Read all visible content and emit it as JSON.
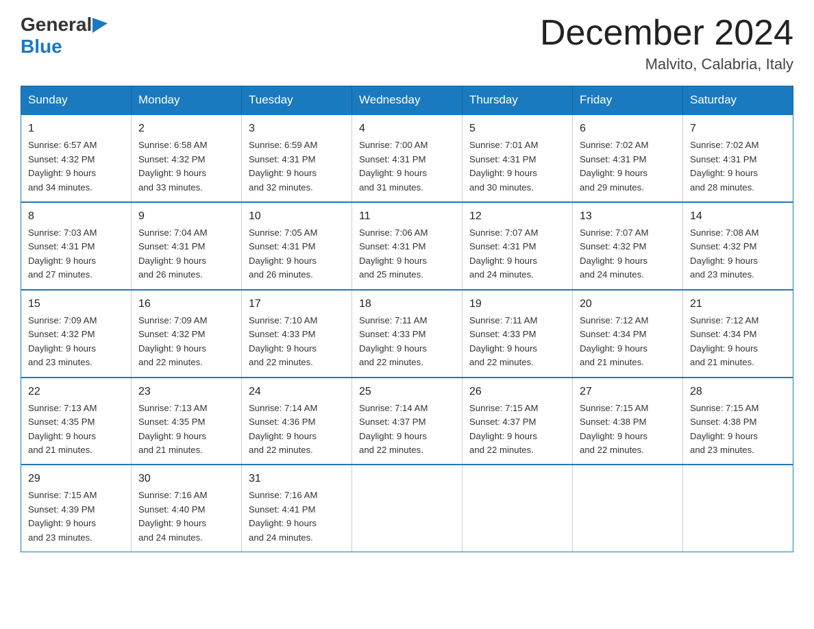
{
  "header": {
    "logo_general": "General",
    "logo_blue": "Blue",
    "title": "December 2024",
    "subtitle": "Malvito, Calabria, Italy"
  },
  "days_of_week": [
    "Sunday",
    "Monday",
    "Tuesday",
    "Wednesday",
    "Thursday",
    "Friday",
    "Saturday"
  ],
  "weeks": [
    [
      {
        "day": "1",
        "sunrise": "6:57 AM",
        "sunset": "4:32 PM",
        "daylight": "9 hours and 34 minutes."
      },
      {
        "day": "2",
        "sunrise": "6:58 AM",
        "sunset": "4:32 PM",
        "daylight": "9 hours and 33 minutes."
      },
      {
        "day": "3",
        "sunrise": "6:59 AM",
        "sunset": "4:31 PM",
        "daylight": "9 hours and 32 minutes."
      },
      {
        "day": "4",
        "sunrise": "7:00 AM",
        "sunset": "4:31 PM",
        "daylight": "9 hours and 31 minutes."
      },
      {
        "day": "5",
        "sunrise": "7:01 AM",
        "sunset": "4:31 PM",
        "daylight": "9 hours and 30 minutes."
      },
      {
        "day": "6",
        "sunrise": "7:02 AM",
        "sunset": "4:31 PM",
        "daylight": "9 hours and 29 minutes."
      },
      {
        "day": "7",
        "sunrise": "7:02 AM",
        "sunset": "4:31 PM",
        "daylight": "9 hours and 28 minutes."
      }
    ],
    [
      {
        "day": "8",
        "sunrise": "7:03 AM",
        "sunset": "4:31 PM",
        "daylight": "9 hours and 27 minutes."
      },
      {
        "day": "9",
        "sunrise": "7:04 AM",
        "sunset": "4:31 PM",
        "daylight": "9 hours and 26 minutes."
      },
      {
        "day": "10",
        "sunrise": "7:05 AM",
        "sunset": "4:31 PM",
        "daylight": "9 hours and 26 minutes."
      },
      {
        "day": "11",
        "sunrise": "7:06 AM",
        "sunset": "4:31 PM",
        "daylight": "9 hours and 25 minutes."
      },
      {
        "day": "12",
        "sunrise": "7:07 AM",
        "sunset": "4:31 PM",
        "daylight": "9 hours and 24 minutes."
      },
      {
        "day": "13",
        "sunrise": "7:07 AM",
        "sunset": "4:32 PM",
        "daylight": "9 hours and 24 minutes."
      },
      {
        "day": "14",
        "sunrise": "7:08 AM",
        "sunset": "4:32 PM",
        "daylight": "9 hours and 23 minutes."
      }
    ],
    [
      {
        "day": "15",
        "sunrise": "7:09 AM",
        "sunset": "4:32 PM",
        "daylight": "9 hours and 23 minutes."
      },
      {
        "day": "16",
        "sunrise": "7:09 AM",
        "sunset": "4:32 PM",
        "daylight": "9 hours and 22 minutes."
      },
      {
        "day": "17",
        "sunrise": "7:10 AM",
        "sunset": "4:33 PM",
        "daylight": "9 hours and 22 minutes."
      },
      {
        "day": "18",
        "sunrise": "7:11 AM",
        "sunset": "4:33 PM",
        "daylight": "9 hours and 22 minutes."
      },
      {
        "day": "19",
        "sunrise": "7:11 AM",
        "sunset": "4:33 PM",
        "daylight": "9 hours and 22 minutes."
      },
      {
        "day": "20",
        "sunrise": "7:12 AM",
        "sunset": "4:34 PM",
        "daylight": "9 hours and 21 minutes."
      },
      {
        "day": "21",
        "sunrise": "7:12 AM",
        "sunset": "4:34 PM",
        "daylight": "9 hours and 21 minutes."
      }
    ],
    [
      {
        "day": "22",
        "sunrise": "7:13 AM",
        "sunset": "4:35 PM",
        "daylight": "9 hours and 21 minutes."
      },
      {
        "day": "23",
        "sunrise": "7:13 AM",
        "sunset": "4:35 PM",
        "daylight": "9 hours and 21 minutes."
      },
      {
        "day": "24",
        "sunrise": "7:14 AM",
        "sunset": "4:36 PM",
        "daylight": "9 hours and 22 minutes."
      },
      {
        "day": "25",
        "sunrise": "7:14 AM",
        "sunset": "4:37 PM",
        "daylight": "9 hours and 22 minutes."
      },
      {
        "day": "26",
        "sunrise": "7:15 AM",
        "sunset": "4:37 PM",
        "daylight": "9 hours and 22 minutes."
      },
      {
        "day": "27",
        "sunrise": "7:15 AM",
        "sunset": "4:38 PM",
        "daylight": "9 hours and 22 minutes."
      },
      {
        "day": "28",
        "sunrise": "7:15 AM",
        "sunset": "4:38 PM",
        "daylight": "9 hours and 23 minutes."
      }
    ],
    [
      {
        "day": "29",
        "sunrise": "7:15 AM",
        "sunset": "4:39 PM",
        "daylight": "9 hours and 23 minutes."
      },
      {
        "day": "30",
        "sunrise": "7:16 AM",
        "sunset": "4:40 PM",
        "daylight": "9 hours and 24 minutes."
      },
      {
        "day": "31",
        "sunrise": "7:16 AM",
        "sunset": "4:41 PM",
        "daylight": "9 hours and 24 minutes."
      },
      null,
      null,
      null,
      null
    ]
  ],
  "labels": {
    "sunrise": "Sunrise:",
    "sunset": "Sunset:",
    "daylight": "Daylight:"
  }
}
